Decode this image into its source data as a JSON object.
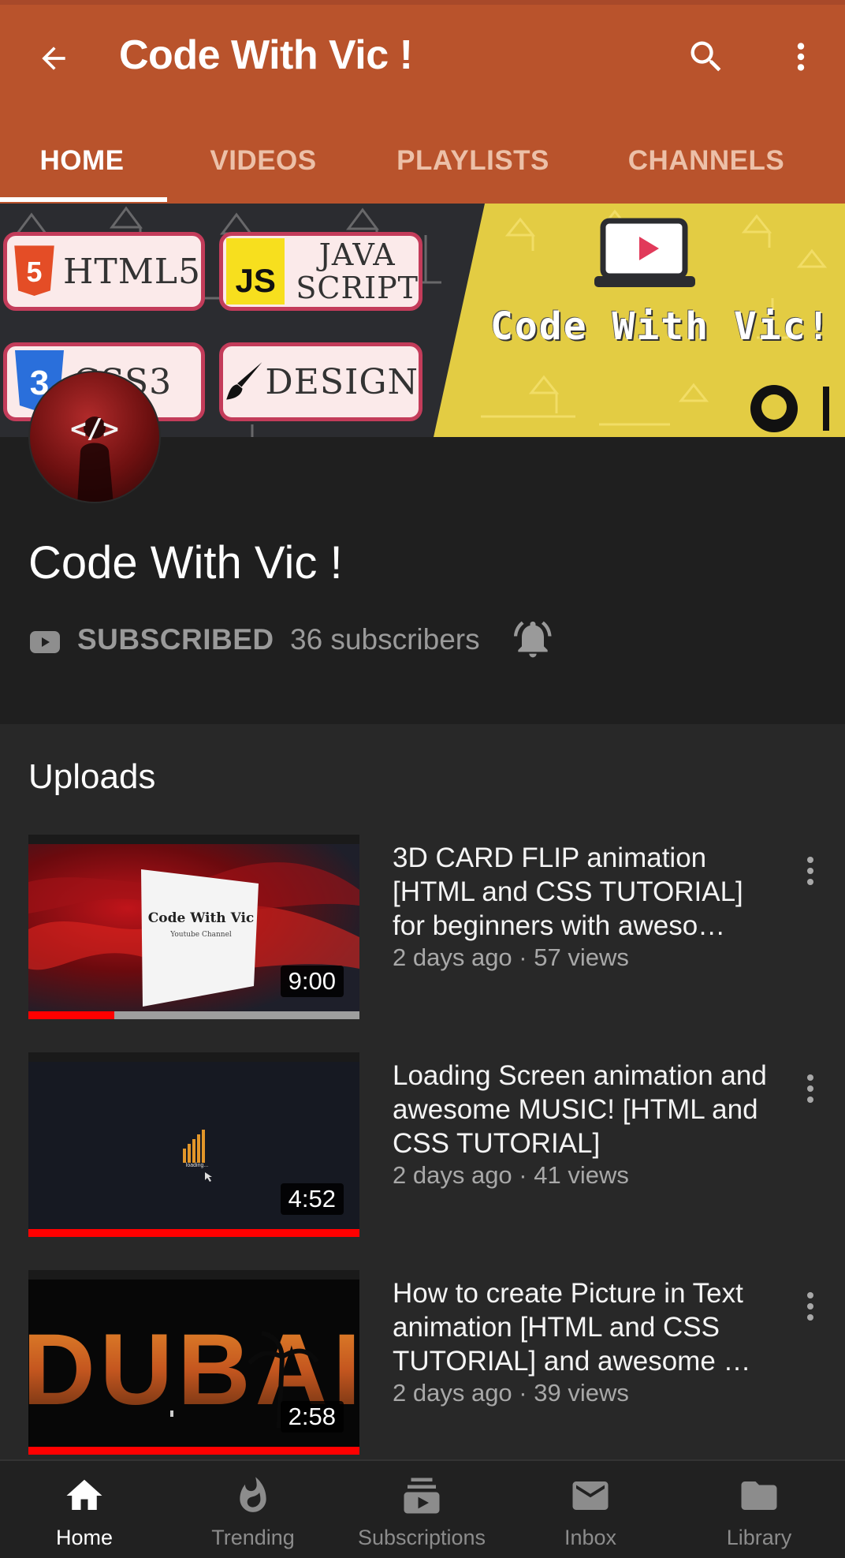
{
  "header": {
    "title": "Code With Vic !",
    "back_icon": "arrow-left-icon",
    "search_icon": "search-icon",
    "more_icon": "more-vert-icon",
    "color": "#b9532c"
  },
  "tabs": [
    {
      "label": "HOME",
      "active": true
    },
    {
      "label": "VIDEOS",
      "active": false
    },
    {
      "label": "PLAYLISTS",
      "active": false
    },
    {
      "label": "CHANNELS",
      "active": false
    }
  ],
  "banner": {
    "chips": [
      "HTML5",
      "JAVA",
      "SCRIPT",
      "CSS3",
      "DESIGN"
    ],
    "js_badge": "JS",
    "brand_text": "Code With Vic!"
  },
  "avatar": {
    "code_text": "</>"
  },
  "channel": {
    "name": "Code With Vic !",
    "subscribe_label": "SUBSCRIBED",
    "subscribers": "36 subscribers"
  },
  "uploads": {
    "title": "Uploads",
    "videos": [
      {
        "title": "3D CARD FLIP animation [HTML and CSS TUTORIAL] for beginners with aweso…",
        "meta": "2 days ago · 57 views",
        "duration": "9:00",
        "watched_fraction": 0.26,
        "thumb_text": "Code With Vic",
        "thumb_subtext": "Youtube Channel"
      },
      {
        "title": "Loading Screen animation and awesome MUSIC! [HTML and CSS TUTORIAL]",
        "meta": "2 days ago · 41 views",
        "duration": "4:52",
        "watched_fraction": 1.0,
        "thumb_text": "loading..."
      },
      {
        "title": "How to create Picture in Text animation  [HTML and CSS TUTORIAL] and awesome …",
        "meta": "2 days ago · 39 views",
        "duration": "2:58",
        "watched_fraction": 1.0,
        "thumb_text": "DUBAI"
      }
    ]
  },
  "bottom_nav": [
    {
      "label": "Home",
      "icon": "home-icon",
      "active": true
    },
    {
      "label": "Trending",
      "icon": "flame-icon",
      "active": false
    },
    {
      "label": "Subscriptions",
      "icon": "subscriptions-icon",
      "active": false
    },
    {
      "label": "Inbox",
      "icon": "mail-icon",
      "active": false
    },
    {
      "label": "Library",
      "icon": "folder-icon",
      "active": false
    }
  ]
}
